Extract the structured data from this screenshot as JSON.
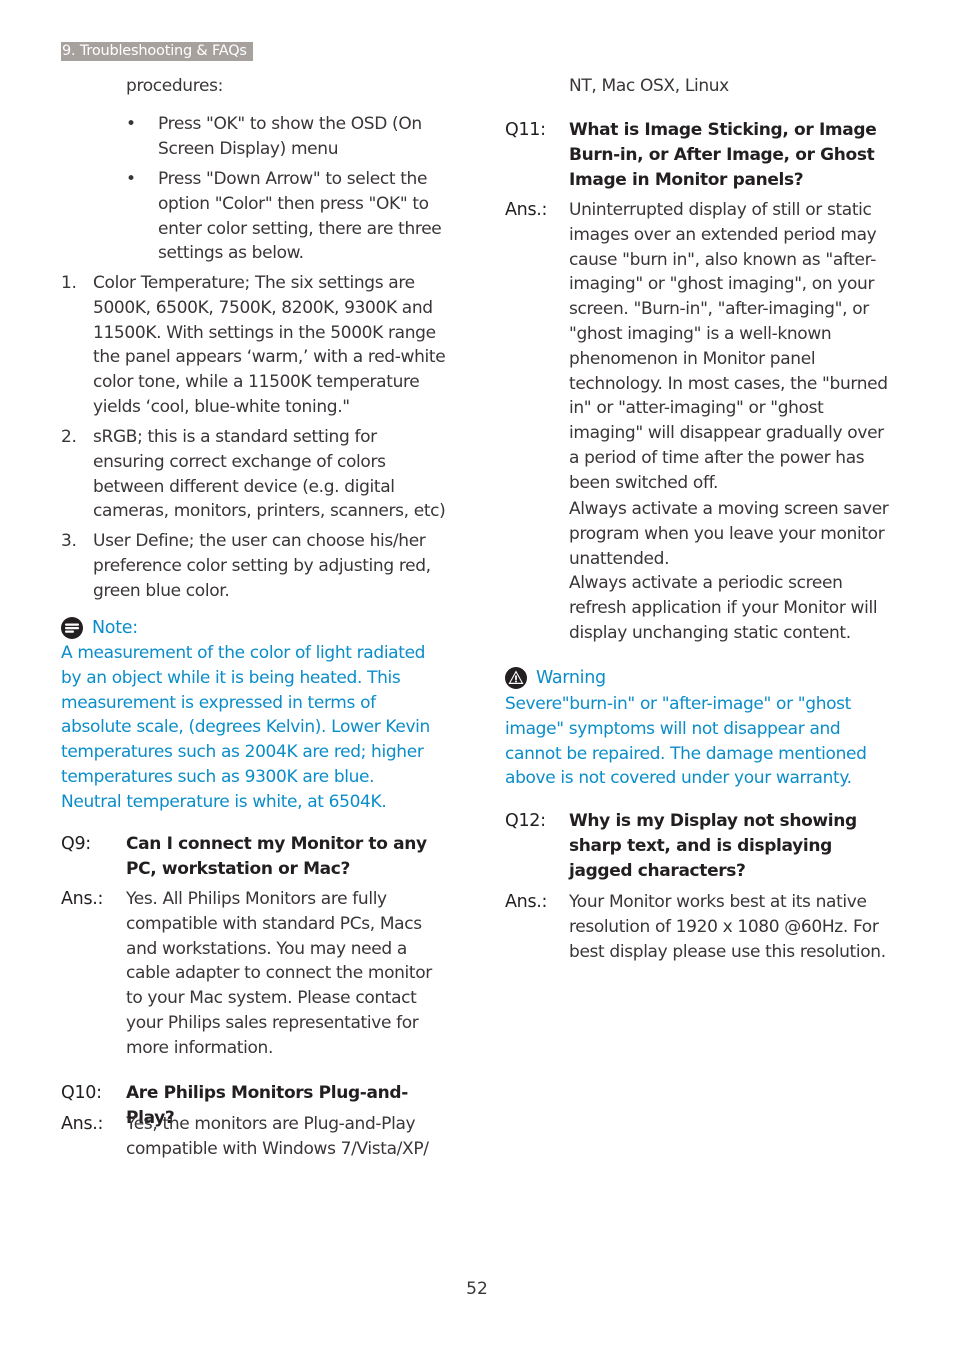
{
  "header": {
    "section_tag": "9. Troubleshooting & FAQs"
  },
  "left": {
    "intro": "procedures:",
    "bullets": [
      "Press \"OK\" to show the OSD (On Screen Display) menu",
      "Press \"Down Arrow\" to select the option \"Color\" then press \"OK\" to enter color setting, there are three settings as below."
    ],
    "bullet_glyph": "•",
    "numbered": [
      {
        "label": "1.",
        "text": "Color Temperature; The six settings are 5000K, 6500K, 7500K, 8200K, 9300K and 11500K. With settings in the 5000K range the panel appears ‘warm,’ with a red-white color tone, while a 11500K temperature yields ‘cool, blue-white toning.\""
      },
      {
        "label": "2.",
        "text": "sRGB; this is a standard setting for ensuring correct exchange of colors between different device (e.g. digital cameras, monitors, printers, scanners, etc)"
      },
      {
        "label": "3.",
        "text": "User Define; the user can choose his/her preference color setting by adjusting red, green blue color."
      }
    ],
    "note": {
      "icon": "note-icon",
      "title": "Note:",
      "text": "A measurement of the color of light radiated by an object while it is being heated. This measurement is expressed in terms of absolute scale, (degrees Kelvin). Lower Kevin temperatures such as 2004K are red; higher temperatures such as 9300K are blue. Neutral temperature is white, at 6504K."
    },
    "q9": {
      "q_label": "Q9:",
      "question": "Can I connect my Monitor to any PC, workstation or Mac?",
      "a_label": "Ans.:",
      "answer": "Yes. All Philips Monitors are fully compatible with standard PCs, Macs and workstations. You may need a cable adapter to connect the monitor to your Mac system. Please contact your Philips sales representative for more information."
    },
    "q10": {
      "q_label": "Q10:",
      "question": "Are Philips Monitors Plug-and- Play?",
      "a_label": "Ans.:",
      "answer": "Yes, the monitors are Plug-and-Play compatible with Windows 7/Vista/XP/"
    }
  },
  "right": {
    "continuation": "NT, Mac OSX, Linux",
    "q11": {
      "q_label": "Q11:",
      "question": "What is Image Sticking, or Image Burn-in, or After Image, or Ghost Image in Monitor panels?",
      "a_label": "Ans.:",
      "answer_paragraphs": [
        "Uninterrupted display of still or static images over an extended period may cause \"burn in\", also known as \"after-imaging\" or \"ghost imaging\", on your screen. \"Burn-in\", \"after-imaging\", or \"ghost imaging\" is a well-known phenomenon in Monitor panel technology. In most cases, the \"burned in\" or \"atter-imaging\" or \"ghost imaging\" will disappear gradually over a period of time after the power has been switched off.",
        "Always activate a moving screen saver program when you leave your monitor unattended.",
        "Always activate a periodic screen refresh application if your Monitor will display unchanging static content."
      ]
    },
    "warning": {
      "icon": "warning-icon",
      "title": "Warning",
      "text": "Severe\"burn-in\" or \"after-image\" or \"ghost image\" symptoms will not disappear and cannot be repaired. The damage mentioned above is not covered under your warranty."
    },
    "q12": {
      "q_label": "Q12:",
      "question": "Why is my Display not showing sharp text, and is displaying jagged characters?",
      "a_label": "Ans.:",
      "answer": "Your Monitor works best at its native resolution of 1920 x 1080 @60Hz. For best display please use this resolution."
    }
  },
  "footer": {
    "page_number": "52"
  },
  "colors": {
    "accent_blue": "#0a8dc9",
    "section_tag_bg": "#a7a19e",
    "body_text": "#3a3536"
  }
}
